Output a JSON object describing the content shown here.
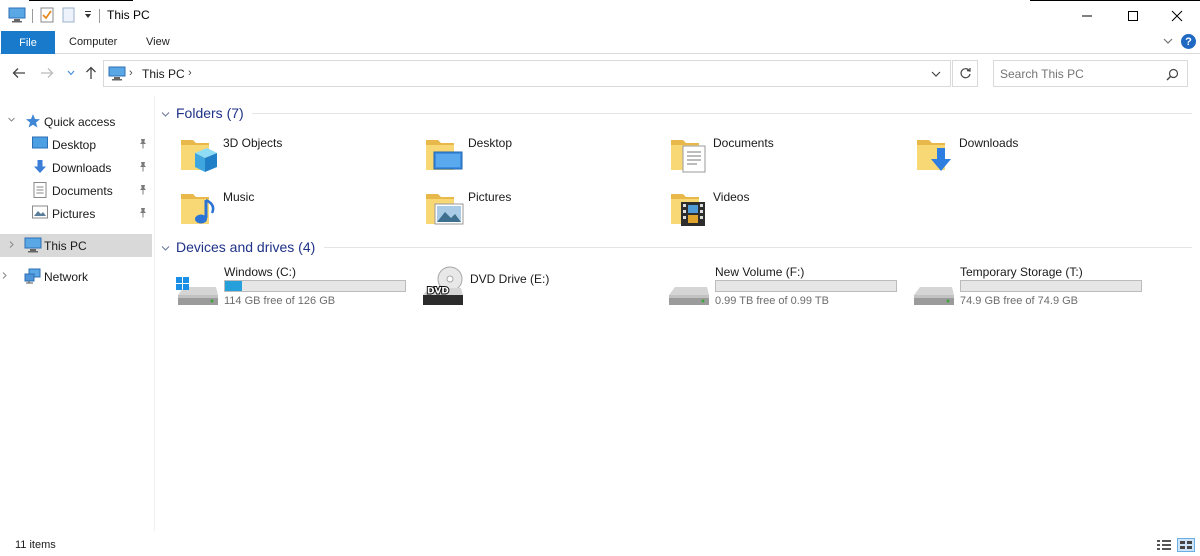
{
  "window": {
    "title": "This PC"
  },
  "ribbon": {
    "tabs": [
      "File",
      "Computer",
      "View"
    ]
  },
  "address": {
    "crumb": "This PC"
  },
  "search": {
    "placeholder": "Search This PC"
  },
  "sidebar": {
    "quick_access": "Quick access",
    "quick_items": [
      "Desktop",
      "Downloads",
      "Documents",
      "Pictures"
    ],
    "this_pc": "This PC",
    "network": "Network"
  },
  "groups": {
    "folders_title": "Folders (7)",
    "drives_title": "Devices and drives (4)"
  },
  "folders": [
    "3D Objects",
    "Desktop",
    "Documents",
    "Downloads",
    "Music",
    "Pictures",
    "Videos"
  ],
  "drives": [
    {
      "name": "Windows (C:)",
      "free": "114 GB free of 126 GB",
      "used_fraction": 0.095
    },
    {
      "name": "DVD Drive (E:)",
      "free": "",
      "used_fraction": null
    },
    {
      "name": "New Volume (F:)",
      "free": "0.99 TB free of 0.99 TB",
      "used_fraction": 0.0
    },
    {
      "name": "Temporary Storage (T:)",
      "free": "74.9 GB free of 74.9 GB",
      "used_fraction": 0.0
    }
  ],
  "status": {
    "count": "11 items"
  },
  "colors": {
    "accent": "#1979ca",
    "group_header": "#1e3287",
    "bar_fill": "#26a0da",
    "folder": "#f8d775"
  }
}
